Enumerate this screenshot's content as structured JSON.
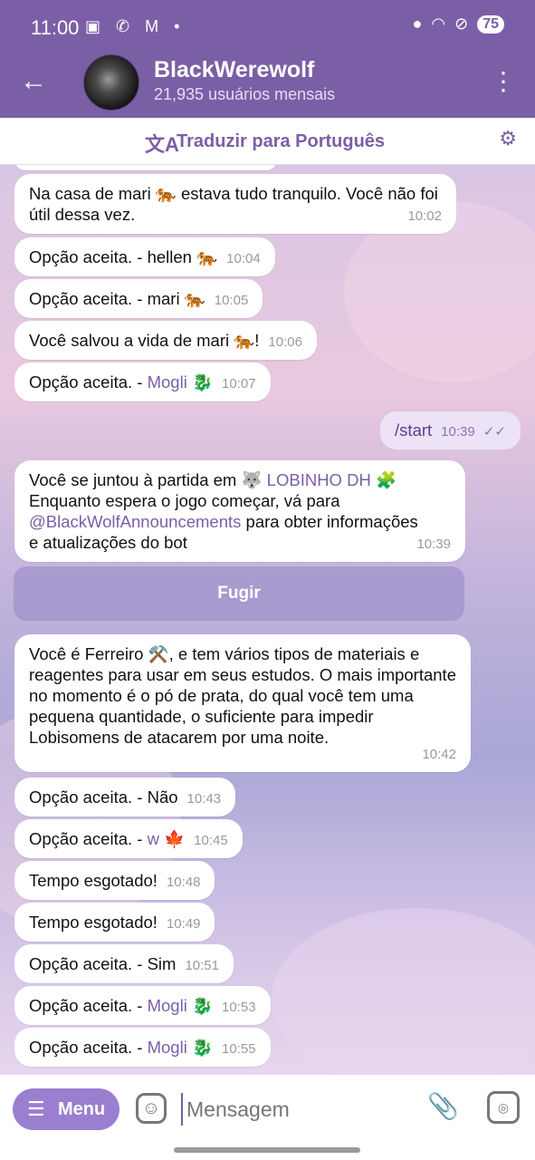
{
  "status": {
    "time": "11:00",
    "icons_left": "▣ ✆ M •",
    "battery": "75"
  },
  "header": {
    "back_icon": "←",
    "title": "BlackWerewolf",
    "subtitle": "21,935 usuários mensais",
    "menu_icon": "⋮"
  },
  "translate": {
    "icon": "文A",
    "label": "Traduzir para Português",
    "settings_icon": "⚙"
  },
  "messages": [
    {
      "text": "Na casa de mari 🐅 estava tudo tranquilo. Você não foi útil dessa vez.",
      "time": "10:02"
    },
    {
      "text": "Opção aceita. - hellen 🐅",
      "time": "10:04"
    },
    {
      "text": "Opção aceita. - mari 🐅",
      "time": "10:05"
    },
    {
      "text": "Você salvou a vida de mari 🐅!",
      "time": "10:06"
    },
    {
      "prefix": "Opção aceita. - ",
      "link": "Mogli",
      "suffix": " 🐉",
      "time": "10:07"
    }
  ],
  "outgoing": {
    "text": "/start",
    "time": "10:39",
    "ticks": "✓✓"
  },
  "join_message": {
    "line1_prefix": "Você se juntou à partida em 🐺 ",
    "line1_link": "LOBINHO DH",
    "line1_suffix": " 🧩",
    "line2": "Enquanto espera o jogo começar, vá para",
    "mention": "@BlackWolfAnnouncements",
    "line3_suffix": " para obter informações",
    "line4": "e atualizações do bot",
    "time": "10:39"
  },
  "fugir_button": "Fugir",
  "role_message": {
    "text": "Você é Ferreiro ⚒️, e tem vários tipos de materiais e reagentes para usar em seus estudos. O mais importante no momento é o pó de prata, do qual você tem uma pequena quantidade, o suficiente para impedir Lobisomens de atacarem por uma noite.",
    "time": "10:42"
  },
  "messages2": [
    {
      "text": "Opção aceita. - Não",
      "time": "10:43"
    },
    {
      "prefix": "Opção aceita. - ",
      "link": "w",
      "suffix": " 🍁",
      "time": "10:45"
    },
    {
      "text": "Tempo esgotado!",
      "time": "10:48"
    },
    {
      "text": "Tempo esgotado!",
      "time": "10:49"
    },
    {
      "text": "Opção aceita. - Sim",
      "time": "10:51"
    },
    {
      "prefix": "Opção aceita. - ",
      "link": "Mogli",
      "suffix": " 🐉",
      "time": "10:53"
    },
    {
      "prefix": "Opção aceita. - ",
      "link": "Mogli",
      "suffix": " 🐉",
      "time": "10:55"
    }
  ],
  "input": {
    "menu_label": "Menu",
    "menu_icon": "☰",
    "placeholder": "Mensagem",
    "sticker_icon": "☺",
    "attach_icon": "📎",
    "camera_icon": "◎"
  },
  "colors": {
    "accent": "#7b5fa6",
    "bubble_out": "#ece3f7",
    "link": "#7b5fa6"
  }
}
